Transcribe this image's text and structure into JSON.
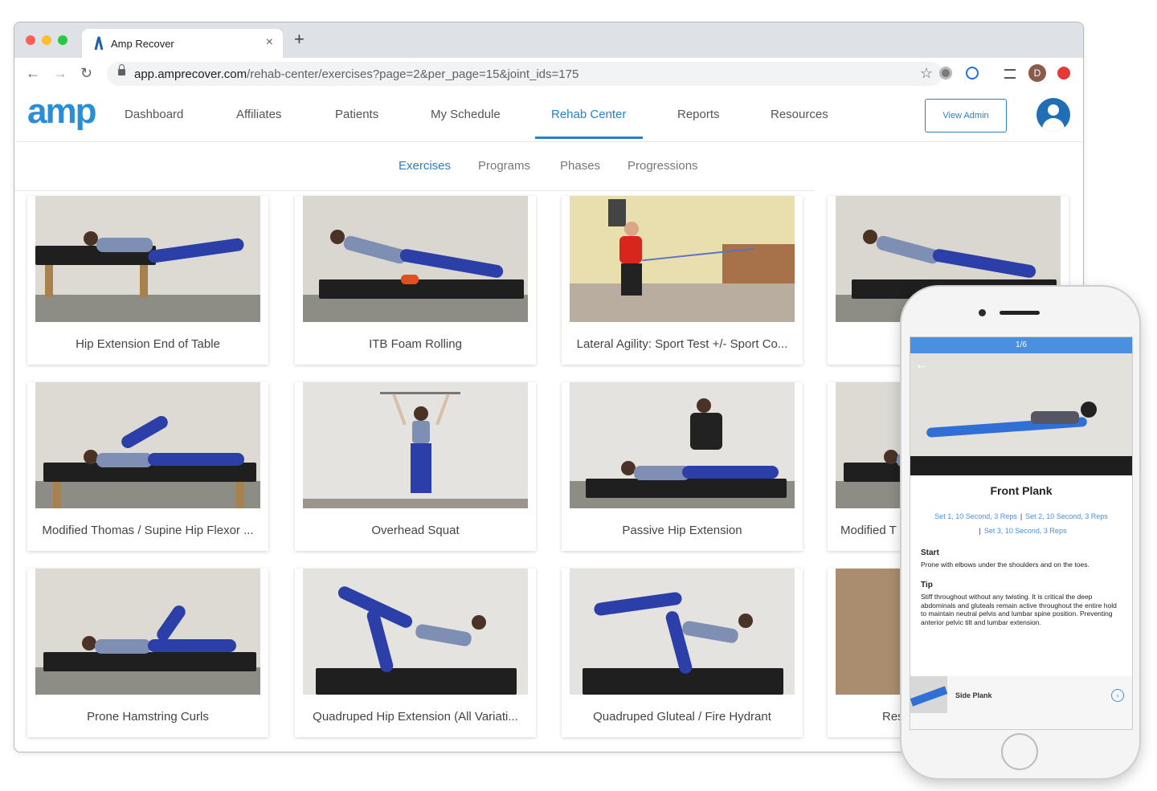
{
  "browser": {
    "tab_title": "Amp Recover",
    "tab_close": "×",
    "new_tab": "+",
    "url_host": "app.amprecover.com",
    "url_path": "/rehab-center/exercises?page=2&per_page=15&joint_ids=175",
    "back": "←",
    "forward": "→",
    "reload": "↻",
    "bookmark": "☆",
    "profile_initial": "D"
  },
  "app": {
    "logo": "amp",
    "nav": [
      "Dashboard",
      "Affiliates",
      "Patients",
      "My Schedule",
      "Rehab Center",
      "Reports",
      "Resources"
    ],
    "active_nav": "Rehab Center",
    "view_admin": "View Admin",
    "subnav": [
      "Exercises",
      "Programs",
      "Phases",
      "Progressions"
    ],
    "active_subnav": "Exercises",
    "accent_color": "#2a7fc9"
  },
  "exercises": [
    "Hip Extension End of Table",
    "ITB Foam Rolling",
    "Lateral Agility: Sport Test +/- Sport Co...",
    "",
    "Modified Thomas / Supine Hip Flexor ...",
    "Overhead Squat",
    "Passive Hip Extension",
    "Modified T",
    "Prone Hamstring Curls",
    "Quadruped Hip Extension (All Variati...",
    "Quadruped Gluteal / Fire Hydrant",
    "Res"
  ],
  "phone": {
    "progress": "1/6",
    "back": "←",
    "title": "Front Plank",
    "sets": [
      "Set 1, 10 Second, 3 Reps",
      "Set 2, 10 Second, 3 Reps",
      "Set 3, 10 Second, 3 Reps"
    ],
    "start_heading": "Start",
    "start_text": "Prone with elbows under the shoulders and on the toes.",
    "tip_heading": "Tip",
    "tip_text": "Stiff throughout without any twisting. It is critical the deep abdominals and gluteals remain active throughout the entire hold to maintain neutral pelvis and lumbar spine position. Preventing anterior pelvic tilt and lumbar extension.",
    "next_label": "Side Plank",
    "next_icon": "›"
  }
}
